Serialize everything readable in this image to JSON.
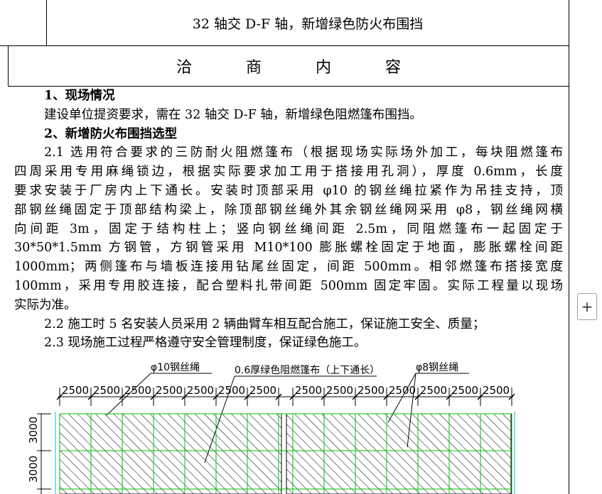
{
  "header": {
    "title": "32 轴交 D-F 轴，新增绿色防火布围挡",
    "section_heading": [
      "洽",
      "商",
      "内",
      "容"
    ]
  },
  "content": {
    "s1_title": "1、现场情况",
    "s1_text": "建设单位提资要求，需在 32 轴交 D-F 轴，新增绿色阻燃篷布围挡。",
    "s2_title": "2、新增防火布围挡选型",
    "p21_lines": [
      "2.1 选用符合要求的三防耐火阻燃篷布（根据现场实际场外加工，每块阻燃篷布",
      "四周采用专用麻绳锁边，根据实际要求加工用于搭接用孔洞），厚度 0.6mm，长度",
      "要求安装于厂房内上下通长。安装时顶部采用 φ10 的钢丝绳拉紧作为吊挂支持，顶",
      "部钢丝绳固定于顶部结构梁上，除顶部钢丝绳外其余钢丝绳网采用 φ8，钢丝绳网横",
      "向间距 3m，固定于结构柱上；竖向钢丝绳间距 2.5m，同阻燃篷布一起固定于",
      "30*50*1.5mm 方钢管，方钢管采用 M10*100 膨胀螺栓固定于地面，膨胀螺栓间距",
      "1000mm；两侧篷布与墙板连接用钻尾丝固定，间距 500mm。相邻燃篷布搭接宽度",
      "100mm，采用专用胶连接，配合塑料扎带间距 500mm 固定牢固。实际工程量以现场"
    ],
    "p21_last": "实际为准。",
    "p22": "2.2 施工时 5 名安装人员采用 2 辆曲臂车相互配合施工，保证施工安全、质量；",
    "p23": "2.3 现场施工过程严格遵守安全管理制度，保证绿色施工。"
  },
  "drawing": {
    "label_phi10": "φ10钢丝绳",
    "label_cloth": "0.6厚绿色阻燃篷布（上下通长）",
    "label_phi8": "φ8钢丝绳",
    "h_dims": [
      "2500",
      "2500",
      "2500",
      "2500",
      "2500",
      "2500",
      "2500",
      "2500",
      "2500",
      "2500",
      "2500",
      "2500",
      "2500",
      "2500"
    ],
    "v_dims": [
      "3000",
      "3000"
    ],
    "colors": {
      "grid": "#00c000",
      "cyan": "#00bcd4",
      "hatch": "#000000"
    }
  },
  "ui": {
    "add_button": "+"
  }
}
